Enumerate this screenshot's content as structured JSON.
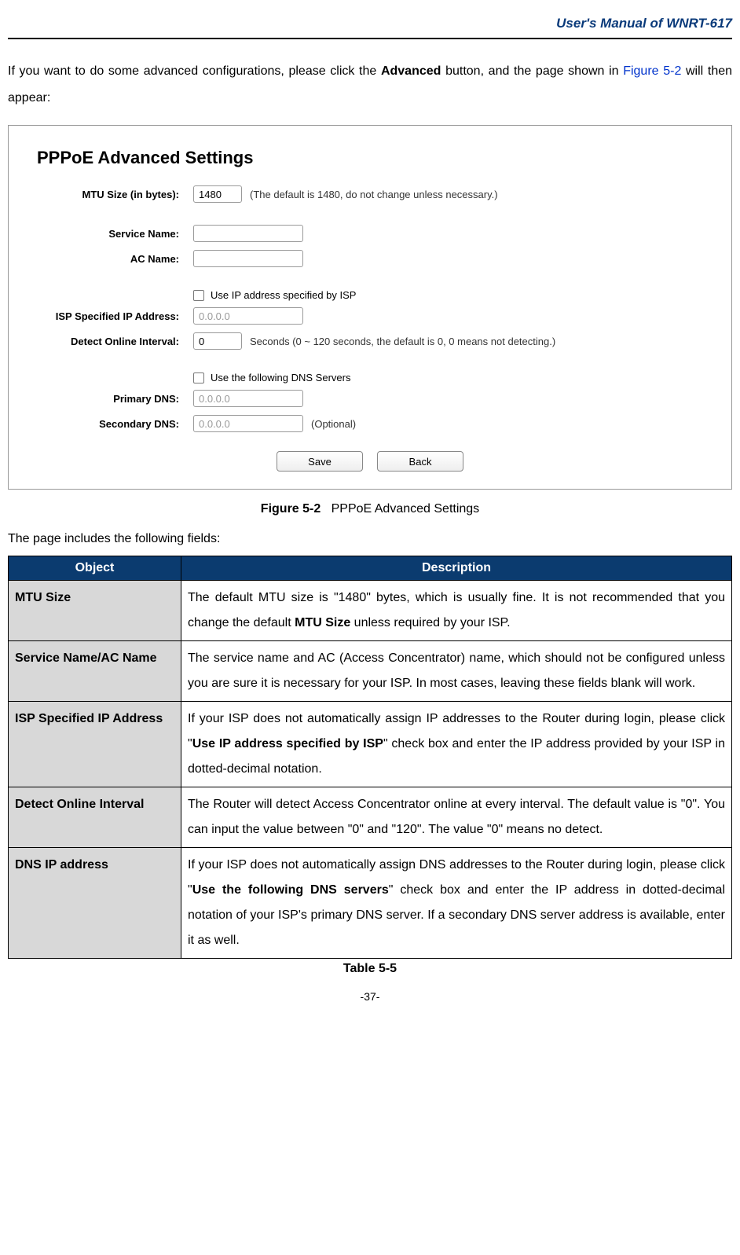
{
  "header": {
    "title": "User's Manual of WNRT-617"
  },
  "intro": {
    "prefix": "If you want to do some advanced configurations, please click the ",
    "bold": "Advanced",
    "mid": " button, and the page shown in ",
    "figref": "Figure 5-2",
    "suffix": " will then appear:"
  },
  "screenshot": {
    "title": "PPPoE Advanced Settings",
    "fields": {
      "mtu_label": "MTU Size (in bytes):",
      "mtu_value": "1480",
      "mtu_note": "(The default is 1480, do not change unless necessary.)",
      "service_label": "Service Name:",
      "service_value": "",
      "ac_label": "AC Name:",
      "ac_value": "",
      "use_ip_label": "Use IP address specified by ISP",
      "isp_ip_label": "ISP Specified IP Address:",
      "isp_ip_value": "0.0.0.0",
      "detect_label": "Detect Online Interval:",
      "detect_value": "0",
      "detect_note": "Seconds (0 ~ 120 seconds, the default is 0, 0 means not detecting.)",
      "use_dns_label": "Use the following DNS Servers",
      "primary_dns_label": "Primary DNS:",
      "primary_dns_value": "0.0.0.0",
      "secondary_dns_label": "Secondary DNS:",
      "secondary_dns_value": "0.0.0.0",
      "secondary_dns_note": "(Optional)"
    },
    "buttons": {
      "save": "Save",
      "back": "Back"
    }
  },
  "fig_caption": {
    "bold": "Figure 5-2",
    "text": "PPPoE Advanced Settings"
  },
  "table_intro": "The page includes the following fields:",
  "table": {
    "head_object": "Object",
    "head_description": "Description",
    "rows": [
      {
        "object": "MTU Size",
        "desc_parts": [
          "The default MTU size is \"1480\" bytes, which is usually fine. It is not recommended that you change the default ",
          "MTU Size",
          " unless required by your ISP."
        ]
      },
      {
        "object": "Service Name/AC Name",
        "desc_parts": [
          "The service name and AC (Access Concentrator) name, which should not be configured unless you are sure it is necessary for your ISP. In most cases, leaving these fields blank will work."
        ]
      },
      {
        "object": "ISP Specified IP Address",
        "desc_parts": [
          "If your ISP does not automatically assign IP addresses to the Router during login, please click \"",
          "Use IP address specified by ISP",
          "\" check box and enter the IP address provided by your ISP in dotted-decimal notation."
        ]
      },
      {
        "object": "Detect Online Interval",
        "desc_parts": [
          "The Router will detect Access Concentrator online at every interval. The default value is \"0\". You can input the value between \"0\" and \"120\". The value \"0\" means no detect."
        ]
      },
      {
        "object": "DNS IP address",
        "desc_parts": [
          "If your ISP does not automatically assign DNS addresses to the Router during login, please click \"",
          "Use the following DNS servers",
          "\" check box and enter the IP address in dotted-decimal notation of your ISP's primary DNS server. If a secondary DNS server address is available, enter it as well."
        ]
      }
    ]
  },
  "table_caption": "Table 5-5",
  "page_number": "-37-"
}
